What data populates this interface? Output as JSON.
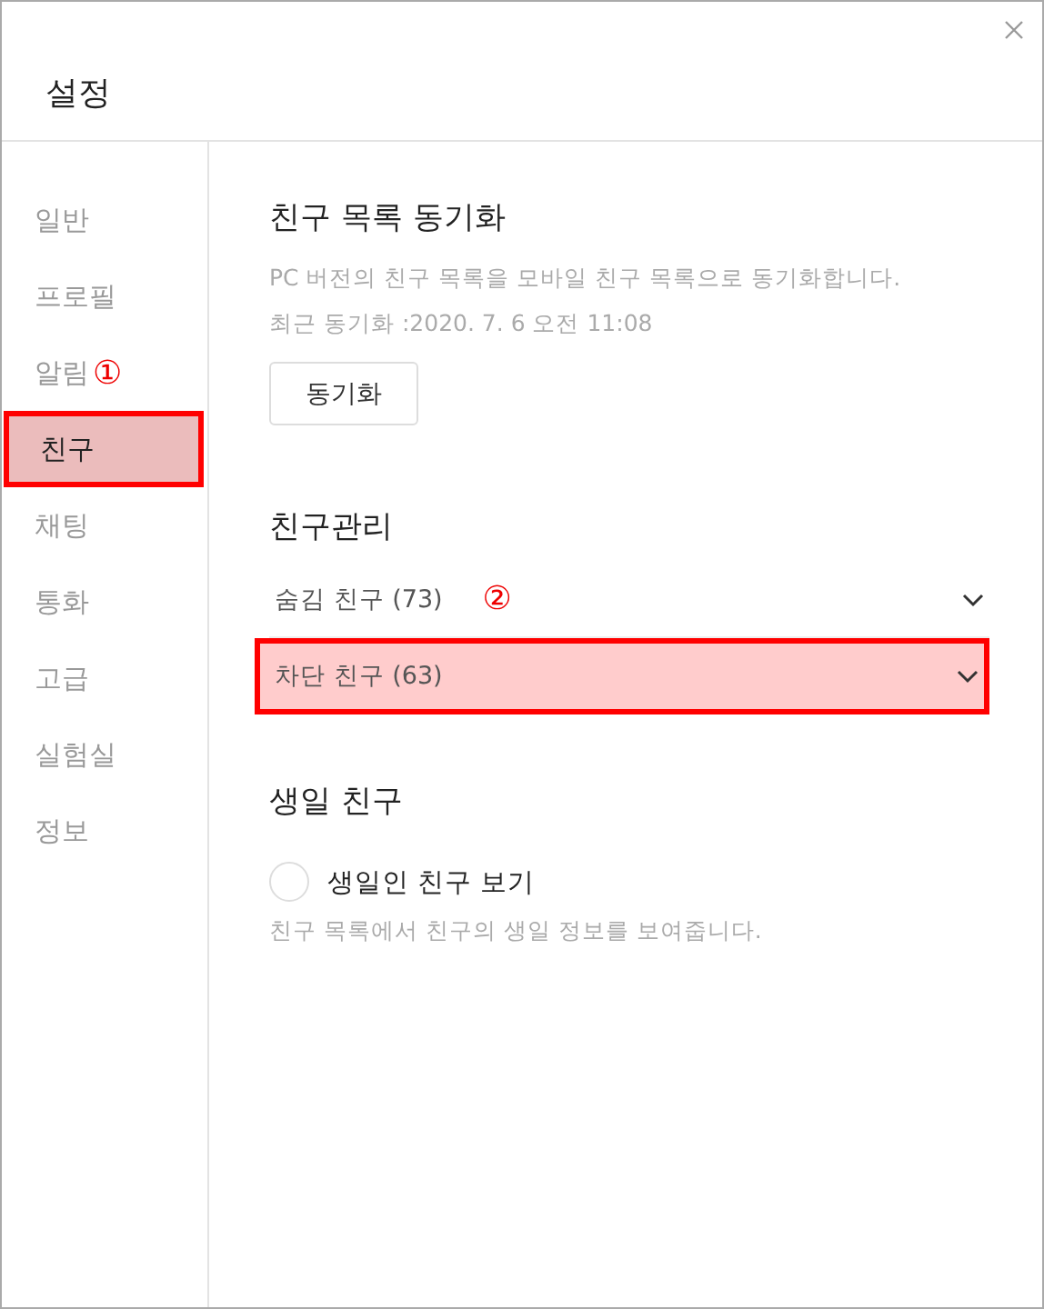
{
  "window": {
    "title": "설정"
  },
  "sidebar": {
    "items": [
      {
        "label": "일반",
        "selected": false,
        "highlighted": false
      },
      {
        "label": "프로필",
        "selected": false,
        "highlighted": false
      },
      {
        "label": "알림",
        "selected": false,
        "highlighted": false,
        "annotation": "①"
      },
      {
        "label": "친구",
        "selected": true,
        "highlighted": true
      },
      {
        "label": "채팅",
        "selected": false,
        "highlighted": false
      },
      {
        "label": "통화",
        "selected": false,
        "highlighted": false
      },
      {
        "label": "고급",
        "selected": false,
        "highlighted": false
      },
      {
        "label": "실험실",
        "selected": false,
        "highlighted": false
      },
      {
        "label": "정보",
        "selected": false,
        "highlighted": false
      }
    ]
  },
  "sync": {
    "title": "친구 목록 동기화",
    "description": "PC 버전의 친구 목록을 모바일 친구 목록으로 동기화합니다.",
    "last_sync": "최근 동기화 :2020. 7. 6 오전 11:08",
    "button": "동기화"
  },
  "management": {
    "title": "친구관리",
    "rows": [
      {
        "label": "숨김 친구 (73)",
        "highlighted": false,
        "annotation": "②"
      },
      {
        "label": "차단 친구 (63)",
        "highlighted": true
      }
    ]
  },
  "birthday": {
    "title": "생일 친구",
    "option": {
      "label": "생일인 친구 보기",
      "checked": false
    },
    "description": "친구 목록에서 친구의 생일 정보를 보여줍니다."
  }
}
